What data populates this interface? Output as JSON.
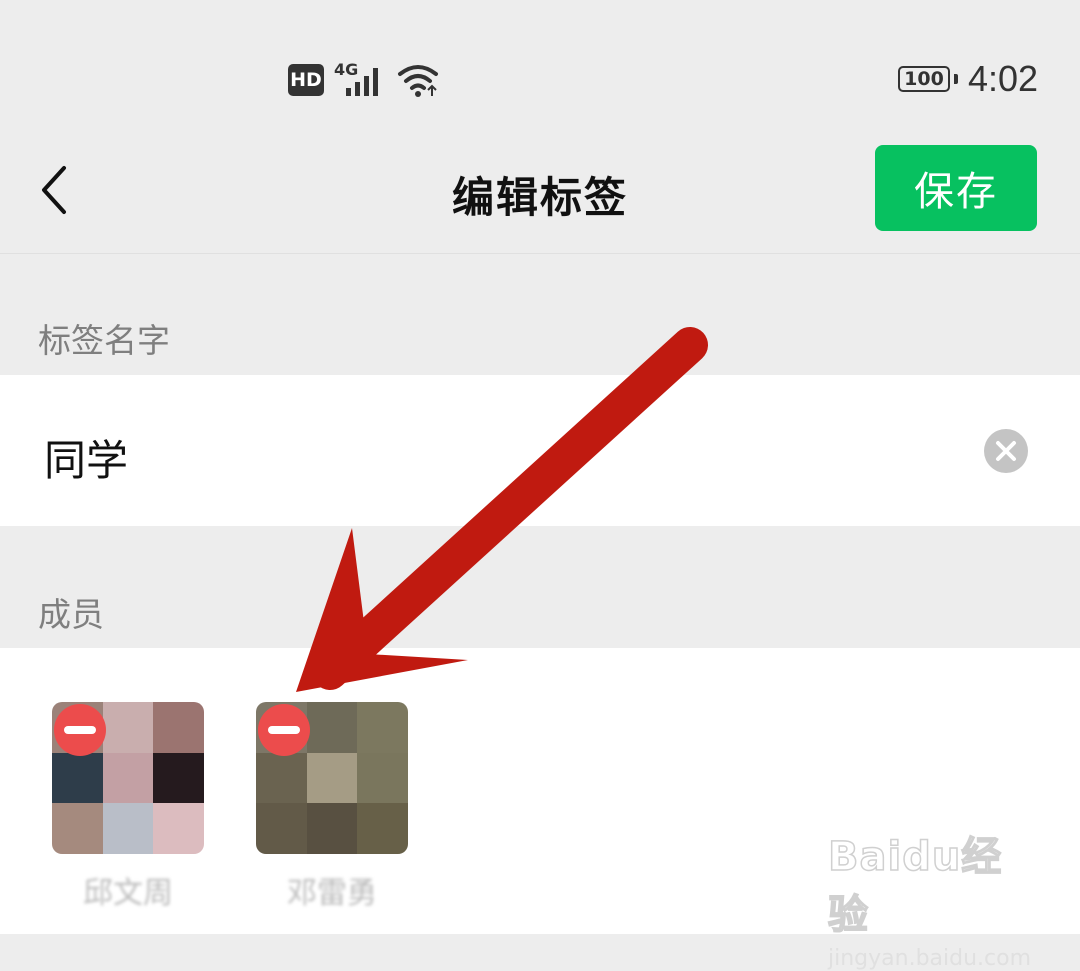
{
  "status_bar": {
    "hd": "HD",
    "network": "4G",
    "battery": "100",
    "time": "4:02"
  },
  "nav": {
    "title": "编辑标签",
    "save_label": "保存"
  },
  "tag_name": {
    "section_label": "标签名字",
    "value": "同学"
  },
  "members": {
    "section_label": "成员",
    "items": [
      {
        "name": "邱文周",
        "tiles": [
          "#9b8279",
          "#c9aeae",
          "#9b7470",
          "#2e3d4a",
          "#c3a0a4",
          "#251a1e",
          "#a58a7e",
          "#b9bec8",
          "#dcbcbf"
        ]
      },
      {
        "name": "邓雷勇",
        "tiles": [
          "#7d7767",
          "#6e6a58",
          "#7c785f",
          "#6a6350",
          "#a59c85",
          "#7a765d",
          "#625a48",
          "#585041",
          "#676048"
        ]
      }
    ]
  },
  "annotation": {
    "arrow_color": "#c01a10"
  },
  "watermark": {
    "brand": "Baidu经验",
    "url": "jingyan.baidu.com"
  },
  "colors": {
    "accent": "#07c160",
    "remove": "#ec4c4c",
    "background": "#ededed"
  }
}
